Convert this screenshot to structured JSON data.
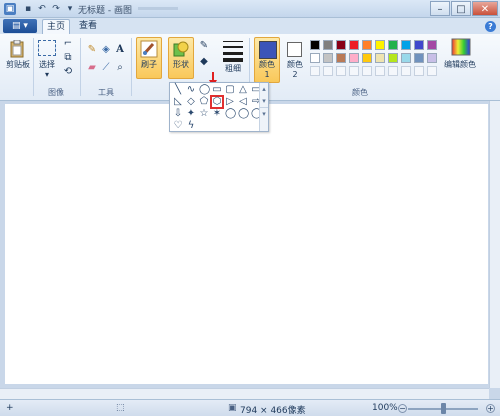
{
  "titlebar": {
    "title": "无标题 - 画图",
    "minimize": "–",
    "maximize": "□",
    "close": "✕"
  },
  "tabs": {
    "menu_button": "▤ ▾",
    "home": "主页",
    "view": "查看"
  },
  "ribbon": {
    "clipboard": {
      "paste_label": "剪贴板",
      "group_label": ""
    },
    "image": {
      "select_label": "选择",
      "group_label": "图像"
    },
    "tools": {
      "group_label": "工具"
    },
    "brush": {
      "label": "刷子"
    },
    "shapes": {
      "label": "形状"
    },
    "size": {
      "label": "粗细"
    },
    "color1": {
      "label": "颜色 1",
      "value": "#3c55b8"
    },
    "color2": {
      "label": "颜色 2",
      "value": "#ffffff"
    },
    "edit_colors": {
      "label": "编辑颜色"
    },
    "colors_group_label": "颜色",
    "palette_row1": [
      "#000000",
      "#7f7f7f",
      "#880015",
      "#ed1c24",
      "#ff7f27",
      "#fff200",
      "#22b14c",
      "#00a2e8",
      "#3f48cc",
      "#a349a4"
    ],
    "palette_row2": [
      "#ffffff",
      "#c3c3c3",
      "#b97a57",
      "#ffaec9",
      "#ffc90e",
      "#efe4b0",
      "#b5e61d",
      "#99d9ea",
      "#7092be",
      "#c8bfe7"
    ]
  },
  "shapes_panel": {
    "row1": [
      "╲",
      "∿",
      "◯",
      "▭",
      "▢",
      "△",
      "▭"
    ],
    "row2": [
      "◺",
      "◇",
      "⬠",
      "⬡",
      "▷",
      "◁",
      "⇨"
    ],
    "row3": [
      "⇩",
      "✦",
      "☆",
      "✶",
      "◯",
      "◯",
      "◯"
    ],
    "row4": [
      "♡",
      "ϟ"
    ],
    "selected_shape": "⬡"
  },
  "status": {
    "canvas_size": "794 × 466像素",
    "zoom": "100%",
    "zoom_level": 0.5
  }
}
